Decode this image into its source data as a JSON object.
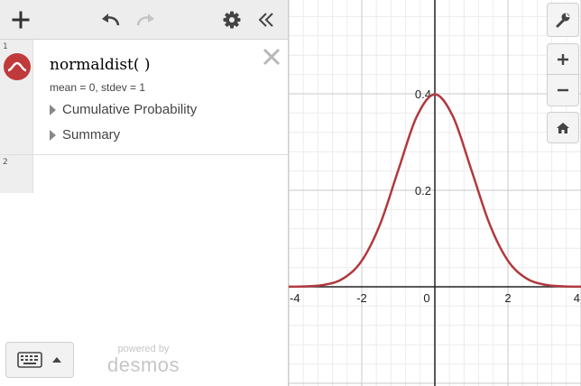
{
  "toolbar": {
    "add_icon": "plus-icon",
    "undo_icon": "undo-arrow-icon",
    "redo_icon": "redo-arrow-icon",
    "settings_icon": "gear-icon",
    "collapse_icon": "double-chevron-left-icon"
  },
  "expressions": [
    {
      "number": "1",
      "name": "normaldist( )",
      "params": "mean = 0, stdev = 1",
      "subitems": [
        "Cumulative Probability",
        "Summary"
      ],
      "color": "#c0393b"
    },
    {
      "number": "2"
    }
  ],
  "footer": {
    "powered_by": "powered by",
    "brand": "desmos"
  },
  "graph_controls": [
    "wrench-icon",
    "plus-icon",
    "minus-icon",
    "home-icon"
  ],
  "chart_data": {
    "type": "line",
    "title": "",
    "xlabel": "",
    "ylabel": "",
    "xlim": [
      -4,
      4
    ],
    "ylim": [
      -0.2,
      0.52
    ],
    "x_ticks": [
      "-4",
      "-2",
      "0",
      "2",
      "4"
    ],
    "y_ticks": [
      "0.2",
      "0.4"
    ],
    "grid": true,
    "series": [
      {
        "color": "#b0393f",
        "x": [
          -4,
          -3.5,
          -3,
          -2.5,
          -2,
          -1.5,
          -1,
          -0.5,
          0,
          0.5,
          1,
          1.5,
          2,
          2.5,
          3,
          3.5,
          4
        ],
        "y": [
          0.0001,
          0.0009,
          0.0044,
          0.0175,
          0.054,
          0.1295,
          0.242,
          0.3521,
          0.3989,
          0.3521,
          0.242,
          0.1295,
          0.054,
          0.0175,
          0.0044,
          0.0009,
          0.0001
        ]
      }
    ]
  }
}
